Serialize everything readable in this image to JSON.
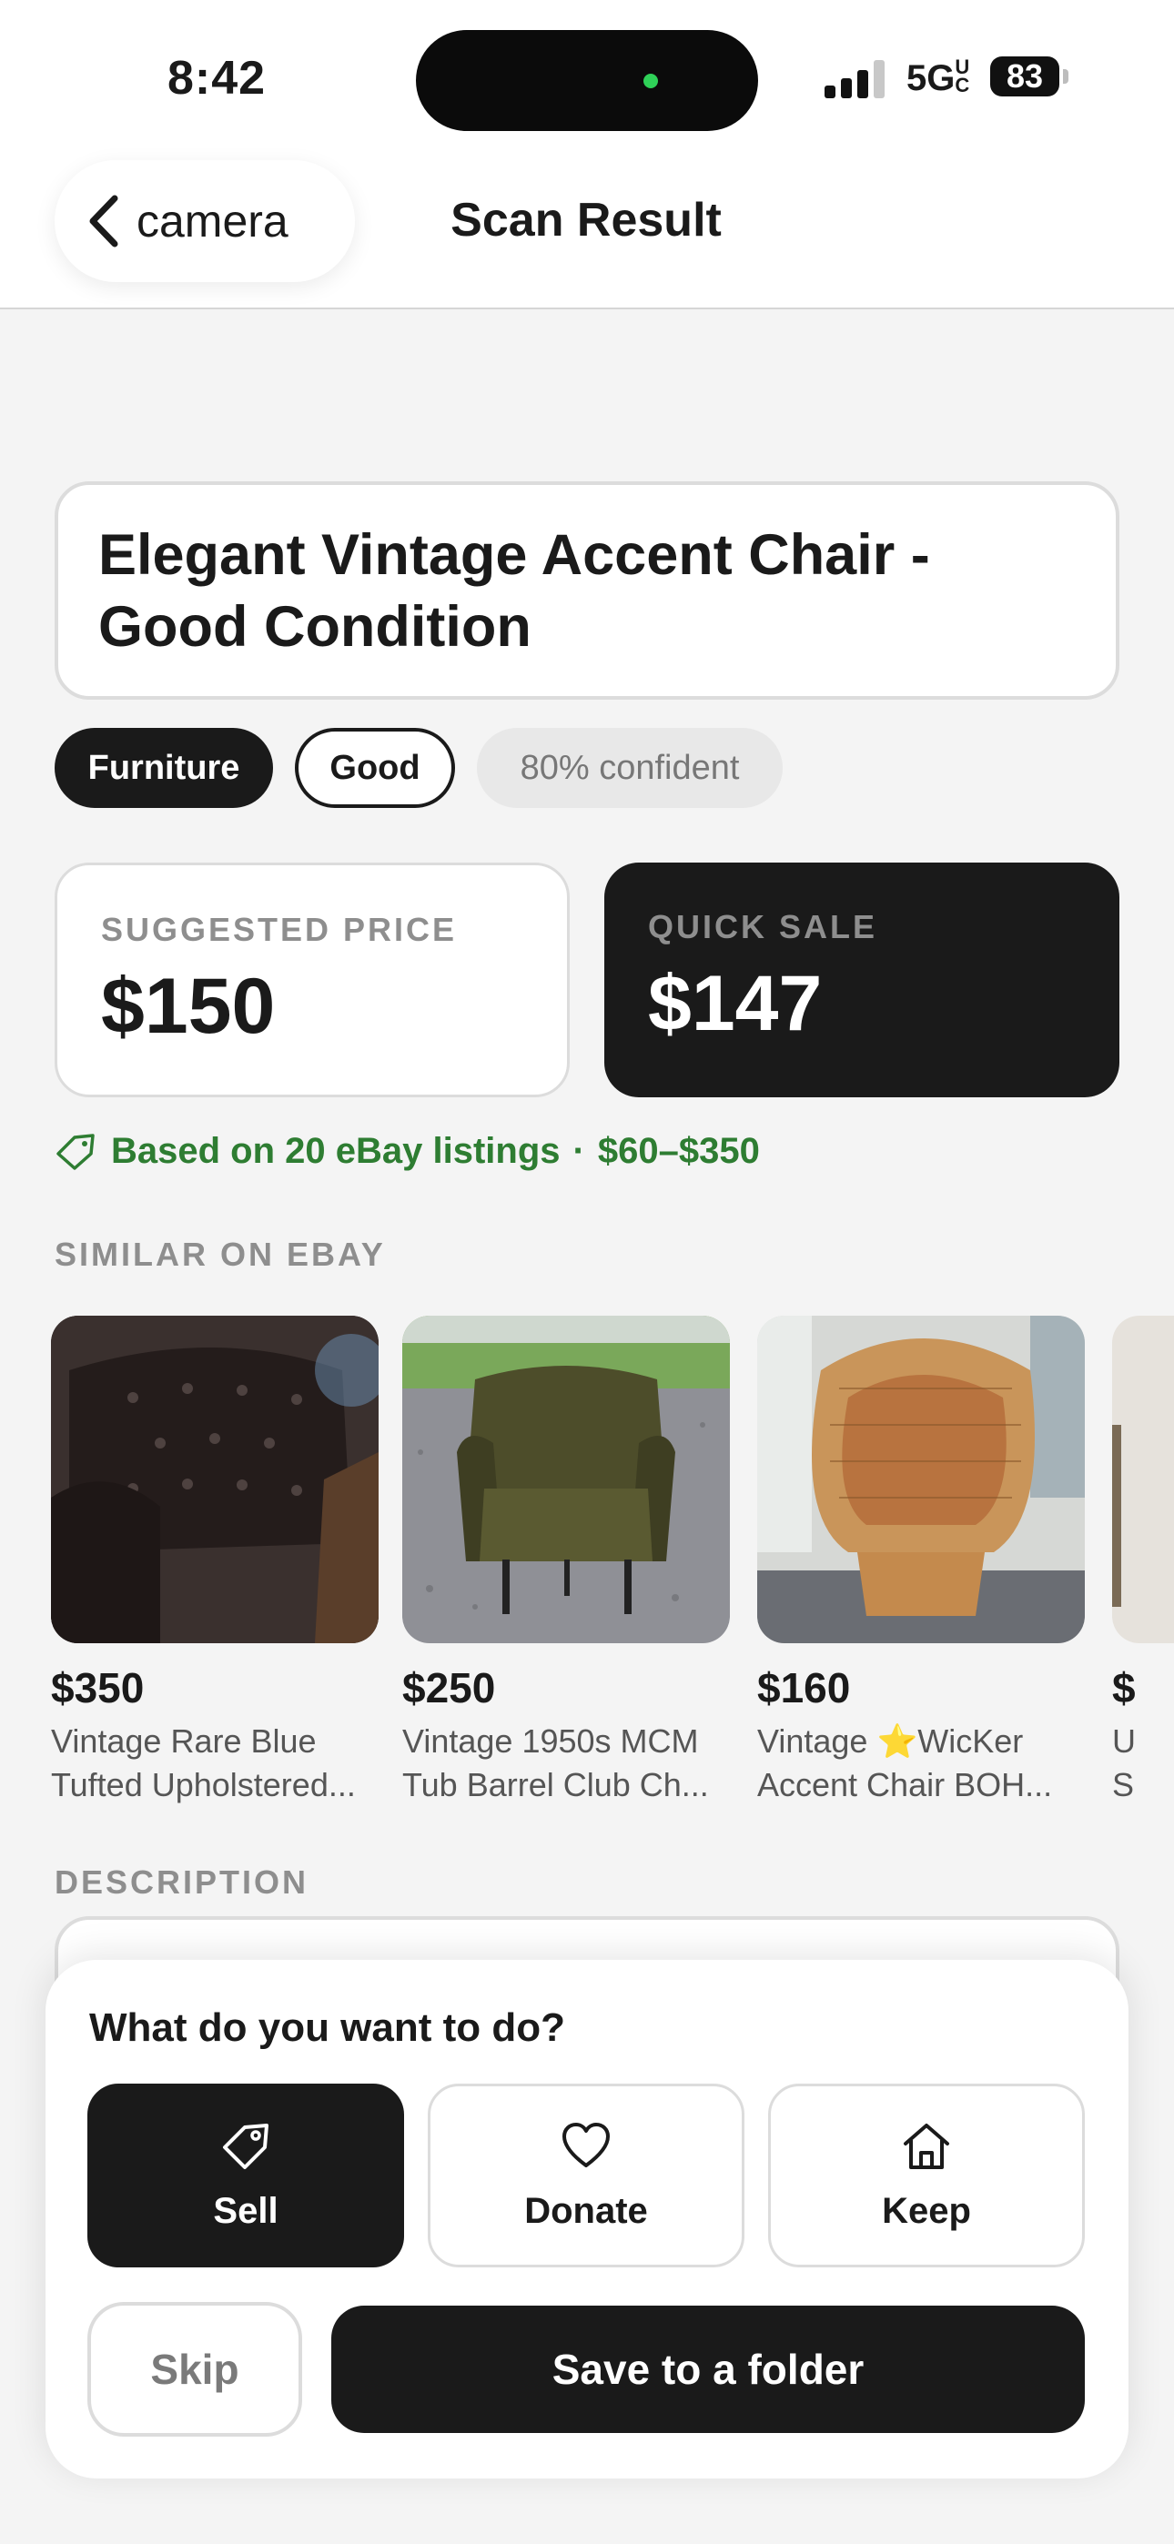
{
  "status_bar": {
    "time": "8:42",
    "network": "5G",
    "network_suffix": "UC",
    "battery": "83"
  },
  "nav": {
    "back_label": "camera",
    "title": "Scan Result"
  },
  "item": {
    "title": "Elegant Vintage Accent Chair - Good Condition",
    "category": "Furniture",
    "condition": "Good",
    "confidence": "80% confident"
  },
  "pricing": {
    "suggested_label": "SUGGESTED PRICE",
    "suggested_value": "$150",
    "quick_label": "QUICK SALE",
    "quick_value": "$147",
    "ebay_basis": "Based on 20 eBay listings",
    "separator": "·",
    "range": "$60–$350"
  },
  "similar": {
    "section_label": "SIMILAR ON EBAY",
    "listings": [
      {
        "price": "$350",
        "title_line1": "Vintage Rare Blue",
        "title_line2": "Tufted Upholstered..."
      },
      {
        "price": "$250",
        "title_line1": "Vintage 1950s MCM",
        "title_line2": "Tub Barrel Club Ch..."
      },
      {
        "price": "$160",
        "title_line1": "Vintage ⭐️WicKer",
        "title_line2": "Accent Chair BOH..."
      },
      {
        "price": "$",
        "title_line1": "U",
        "title_line2": "S"
      }
    ]
  },
  "description": {
    "section_label": "DESCRIPTION"
  },
  "sheet": {
    "title": "What do you want to do?",
    "actions": [
      {
        "label": "Sell",
        "icon": "tag-icon"
      },
      {
        "label": "Donate",
        "icon": "heart-icon"
      },
      {
        "label": "Keep",
        "icon": "home-icon"
      }
    ],
    "skip_label": "Skip",
    "save_label": "Save to a folder"
  },
  "colors": {
    "accent_dark": "#1a1a1a",
    "success_green": "#2e7d32",
    "muted": "#8e8e8e"
  }
}
